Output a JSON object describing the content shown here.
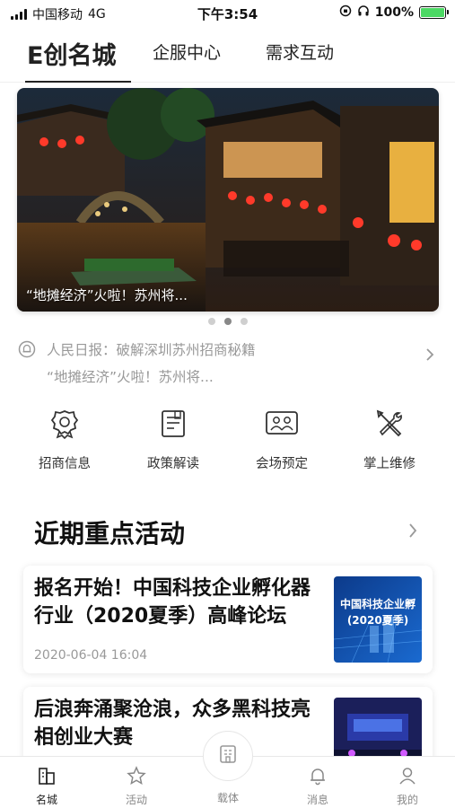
{
  "status_bar": {
    "carrier": "中国移动",
    "network": "4G",
    "time": "下午3:54",
    "battery": "100%",
    "battery_color": "#4cd964"
  },
  "top_tabs": [
    {
      "label": "E创名城",
      "active": true
    },
    {
      "label": "企服中心",
      "active": false
    },
    {
      "label": "需求互动",
      "active": false
    }
  ],
  "banner": {
    "caption": "“地摊经济”火啦！苏州将...",
    "dots": 3,
    "active_dot": 2
  },
  "news": {
    "icon": "bell-icon",
    "line1": "人民日报：破解深圳苏州招商秘籍",
    "line2": "“地摊经济”火啦！苏州将..."
  },
  "quick_actions": [
    {
      "label": "招商信息",
      "icon": "investment-badge-icon"
    },
    {
      "label": "政策解读",
      "icon": "policy-document-icon"
    },
    {
      "label": "会场预定",
      "icon": "meeting-room-icon"
    },
    {
      "label": "掌上维修",
      "icon": "repair-tools-icon"
    }
  ],
  "section": {
    "title": "近期重点活动"
  },
  "cards": [
    {
      "title": "报名开始！中国科技企业孵化器行业（2020夏季）高峰论坛",
      "date": "2020-06-04 16:04",
      "thumb_line1": "中国科技企业孵",
      "thumb_line2": "(2020夏季)"
    },
    {
      "title": "后浪奔涌聚沧浪，众多黑科技亮相创业大赛",
      "date": ""
    }
  ],
  "bottom_nav": [
    {
      "label": "名城",
      "icon": "city-icon",
      "active": true
    },
    {
      "label": "活动",
      "icon": "star-icon",
      "active": false
    },
    {
      "label": "载体",
      "icon": "building-icon",
      "active": false
    },
    {
      "label": "消息",
      "icon": "bell-icon",
      "active": false
    },
    {
      "label": "我的",
      "icon": "user-icon",
      "active": false
    }
  ],
  "colors": {
    "text_primary": "#222222",
    "text_secondary": "#999999",
    "accent_thumb": "#1a4fa8"
  }
}
